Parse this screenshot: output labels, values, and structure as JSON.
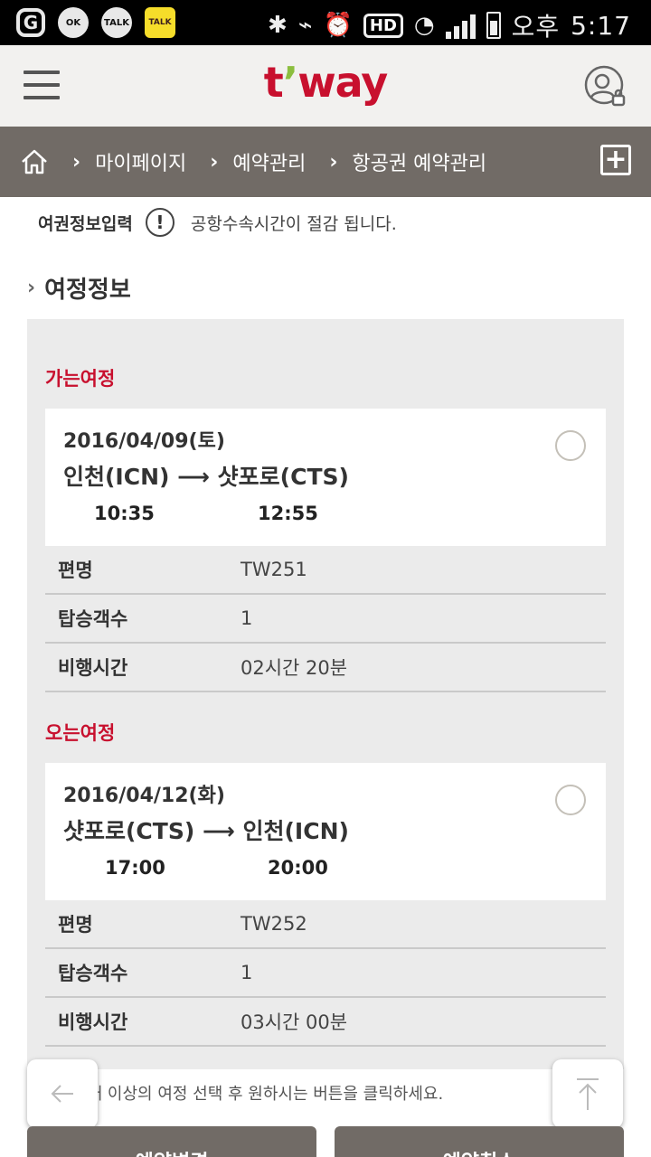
{
  "status_bar": {
    "left_icons": [
      "G",
      "OK",
      "TALK",
      "TALK"
    ],
    "ampm": "오후",
    "time": "5:17",
    "hd": "HD"
  },
  "header": {
    "logo_main": "t",
    "logo_apos": "’",
    "logo_rest": "way",
    "menu_icon": "hamburger-icon",
    "account_icon": "user-lock-icon"
  },
  "breadcrumb": {
    "home_icon": "home-icon",
    "sep": "›",
    "items": [
      "마이페이지",
      "예약관리",
      "항공권 예약관리"
    ],
    "plus": "+"
  },
  "notice": {
    "label": "여권정보입력",
    "icon": "!",
    "message": "공항수속시간이 절감 됩니다."
  },
  "section_title": "여정정보",
  "section_chevron": "›",
  "legs": [
    {
      "label": "가는여정",
      "date": "2016/04/09(토)",
      "route": "인천(ICN) ⟶ 샷포로(CTS)",
      "depart": "10:35",
      "arrive": "12:55",
      "rows": [
        {
          "key": "편명",
          "value": "TW251"
        },
        {
          "key": "탑승객수",
          "value": "1"
        },
        {
          "key": "비행시간",
          "value": "02시간 20분"
        }
      ]
    },
    {
      "label": "오는여정",
      "date": "2016/04/12(화)",
      "route": "샷포로(CTS) ⟶ 인천(ICN)",
      "depart": "17:00",
      "arrive": "20:00",
      "rows": [
        {
          "key": "편명",
          "value": "TW252"
        },
        {
          "key": "탑승객수",
          "value": "1"
        },
        {
          "key": "비행시간",
          "value": "03시간 00분"
        }
      ]
    }
  ],
  "bottom_message": "• 최소 1개 이상의 여정 선택 후 원하시는 버튼을 클릭하세요.",
  "buttons": {
    "change": "예약변경",
    "cancel": "예약취소"
  },
  "colors": {
    "brand_red": "#c8102e",
    "brand_green": "#8cbe3f",
    "bar_gray": "#716b66"
  }
}
